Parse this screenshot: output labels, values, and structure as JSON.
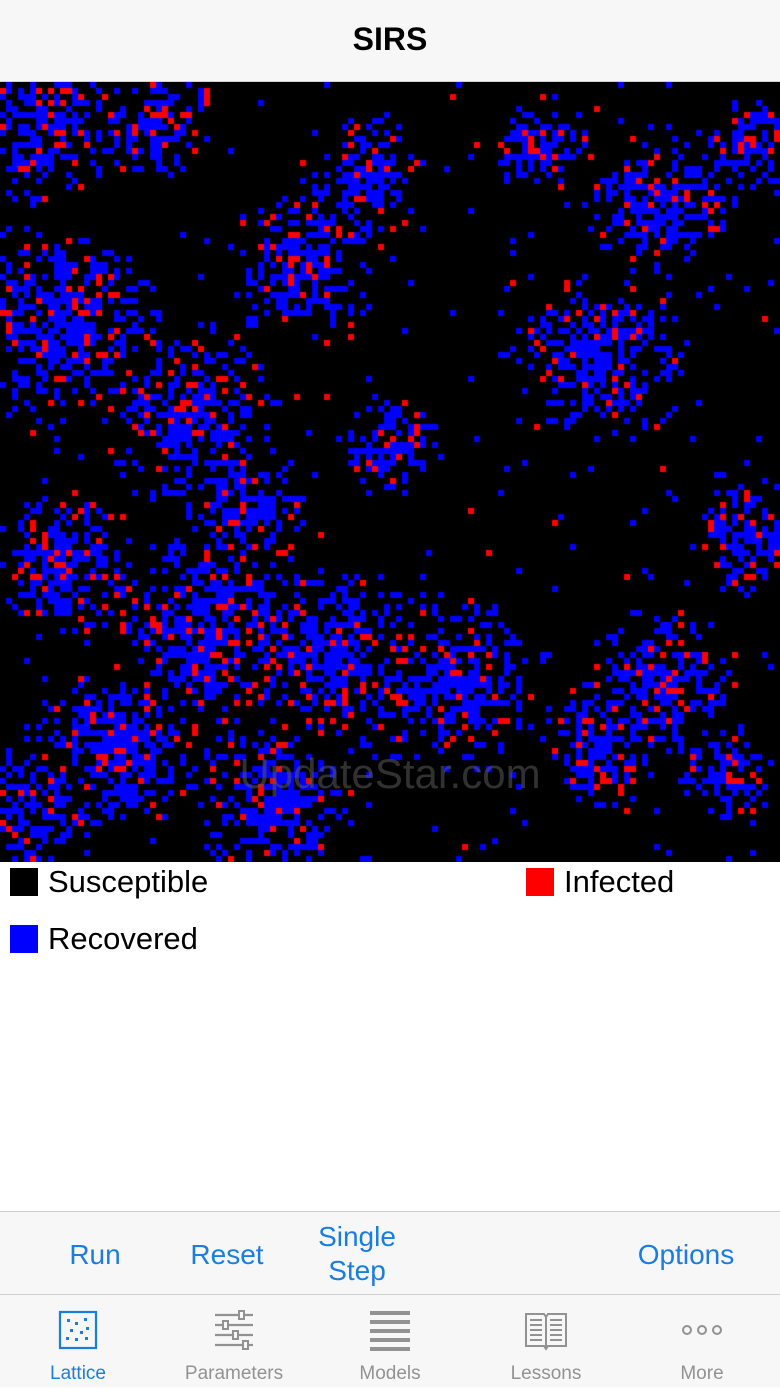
{
  "nav": {
    "title": "SIRS"
  },
  "lattice": {
    "watermark": "UpdateStar.com",
    "colors": {
      "susceptible": "#000000",
      "infected": "#ff0000",
      "recovered": "#0000ff"
    }
  },
  "legend": {
    "susceptible": {
      "label": "Susceptible",
      "color": "#000000"
    },
    "infected": {
      "label": "Infected",
      "color": "#ff0000"
    },
    "recovered": {
      "label": "Recovered",
      "color": "#0000ff"
    }
  },
  "toolbar": {
    "run_label": "Run",
    "reset_label": "Reset",
    "step_line1": "Single",
    "step_line2": "Step",
    "options_label": "Options"
  },
  "tabs": [
    {
      "label": "Lattice",
      "icon": "lattice-icon",
      "active": true
    },
    {
      "label": "Parameters",
      "icon": "sliders-icon",
      "active": false
    },
    {
      "label": "Models",
      "icon": "list-icon",
      "active": false
    },
    {
      "label": "Lessons",
      "icon": "book-icon",
      "active": false
    },
    {
      "label": "More",
      "icon": "more-icon",
      "active": false
    }
  ],
  "accent_color": "#1a7ee0"
}
